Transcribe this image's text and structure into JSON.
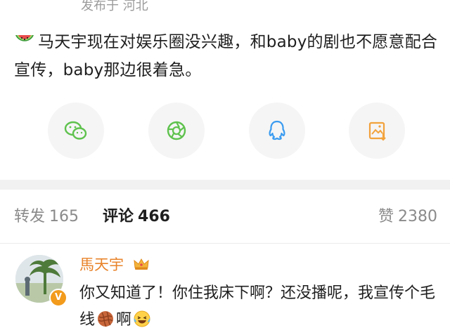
{
  "post": {
    "meta": "发布于 河北",
    "emoji_icon": "watermelon-icon",
    "text": "马天宇现在对娱乐圈没兴趣，和baby的剧也不愿意配合宣传，baby那边很着急。"
  },
  "share": {
    "items": [
      {
        "icon": "wechat-icon",
        "color": "#5ec24d"
      },
      {
        "icon": "moments-icon",
        "color": "#5ec24d"
      },
      {
        "icon": "qq-icon",
        "color": "#3a9bf0"
      },
      {
        "icon": "save-image-icon",
        "color": "#f2a23b"
      }
    ]
  },
  "tabs": {
    "repost_label": "转发",
    "repost_count": "165",
    "comment_label": "评论",
    "comment_count": "466",
    "like_label": "赞",
    "like_count": "2380"
  },
  "comment": {
    "username": "馬天宇",
    "badge_icon": "crown-icon",
    "verified_mark": "V",
    "text_part1": "你又知道了！你住我床下啊？还没播呢，我宣传个毛线",
    "text_part2": "啊",
    "inline_icons": [
      "yarn-ball-icon",
      "laughing-tears-icon"
    ]
  },
  "colors": {
    "username": "#e8832a",
    "muted_text": "#8a8a8a",
    "divider_band": "#f1f1f1"
  }
}
